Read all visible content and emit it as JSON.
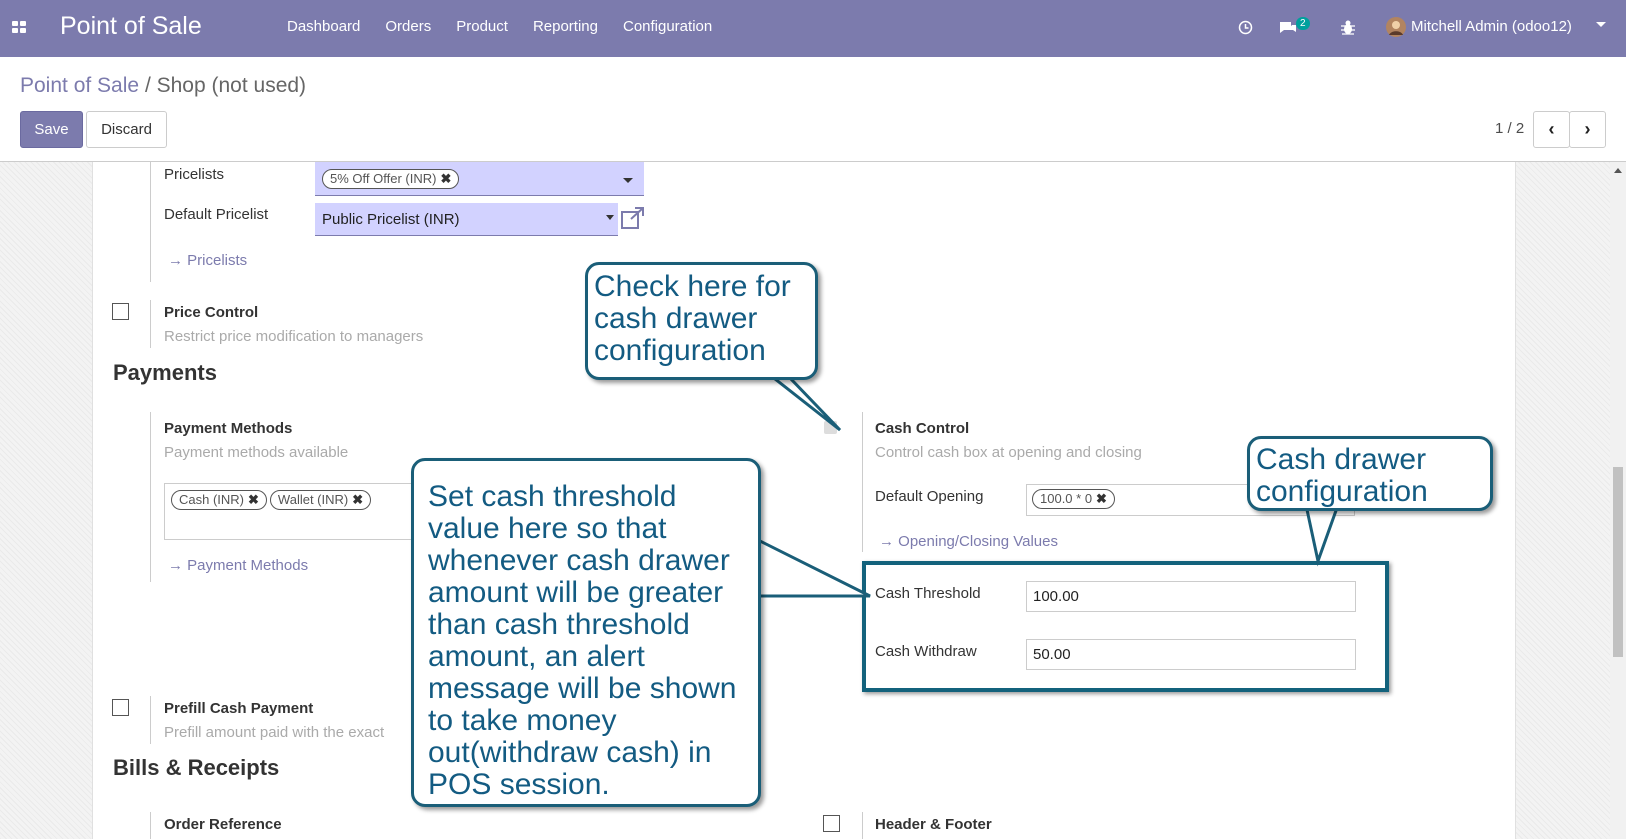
{
  "topbar": {
    "app_title": "Point of Sale",
    "menu": [
      "Dashboard",
      "Orders",
      "Product",
      "Reporting",
      "Configuration"
    ],
    "chat_count": "2",
    "user": "Mitchell Admin (odoo12)"
  },
  "control": {
    "breadcrumb_root": "Point of Sale",
    "breadcrumb_sep": "/",
    "breadcrumb_current": "Shop (not used)",
    "save_label": "Save",
    "discard_label": "Discard",
    "pager": "1 / 2"
  },
  "form": {
    "pricelists_label": "Pricelists",
    "pricelists_tags": [
      "5% Off Offer (INR)"
    ],
    "default_pricelist_label": "Default Pricelist",
    "default_pricelist_value": "Public Pricelist (INR)",
    "pricelists_link": "Pricelists",
    "price_control_title": "Price Control",
    "price_control_desc": "Restrict price modification to managers",
    "payments_heading": "Payments",
    "payment_methods_title": "Payment Methods",
    "payment_methods_desc": "Payment methods available",
    "payment_tags": [
      "Cash (INR)",
      "Wallet (INR)"
    ],
    "payment_methods_link": "Payment Methods",
    "cash_control_title": "Cash Control",
    "cash_control_desc": "Control cash box at opening and closing",
    "default_opening_label": "Default Opening",
    "default_opening_tag": "100.0 * 0",
    "opening_closing_link": "Opening/Closing Values",
    "cash_threshold_label": "Cash Threshold",
    "cash_threshold_value": "100.00",
    "cash_withdraw_label": "Cash Withdraw",
    "cash_withdraw_value": "50.00",
    "prefill_title": "Prefill Cash Payment",
    "prefill_desc": "Prefill amount paid with the exact",
    "bills_heading": "Bills & Receipts",
    "order_reference_title": "Order Reference",
    "header_footer_title": "Header & Footer"
  },
  "callouts": {
    "check_here": "Check here for cash drawer configuration",
    "threshold": "Set cash threshold value here so that whenever cash drawer amount will be greater than cash threshold amount, an alert message will be shown to take money out(withdraw cash) in POS session.",
    "drawer_config": "Cash drawer configuration"
  },
  "colors": {
    "brand": "#7c7bad",
    "callout_border": "#1a5e78",
    "callout_text": "#135b82"
  }
}
